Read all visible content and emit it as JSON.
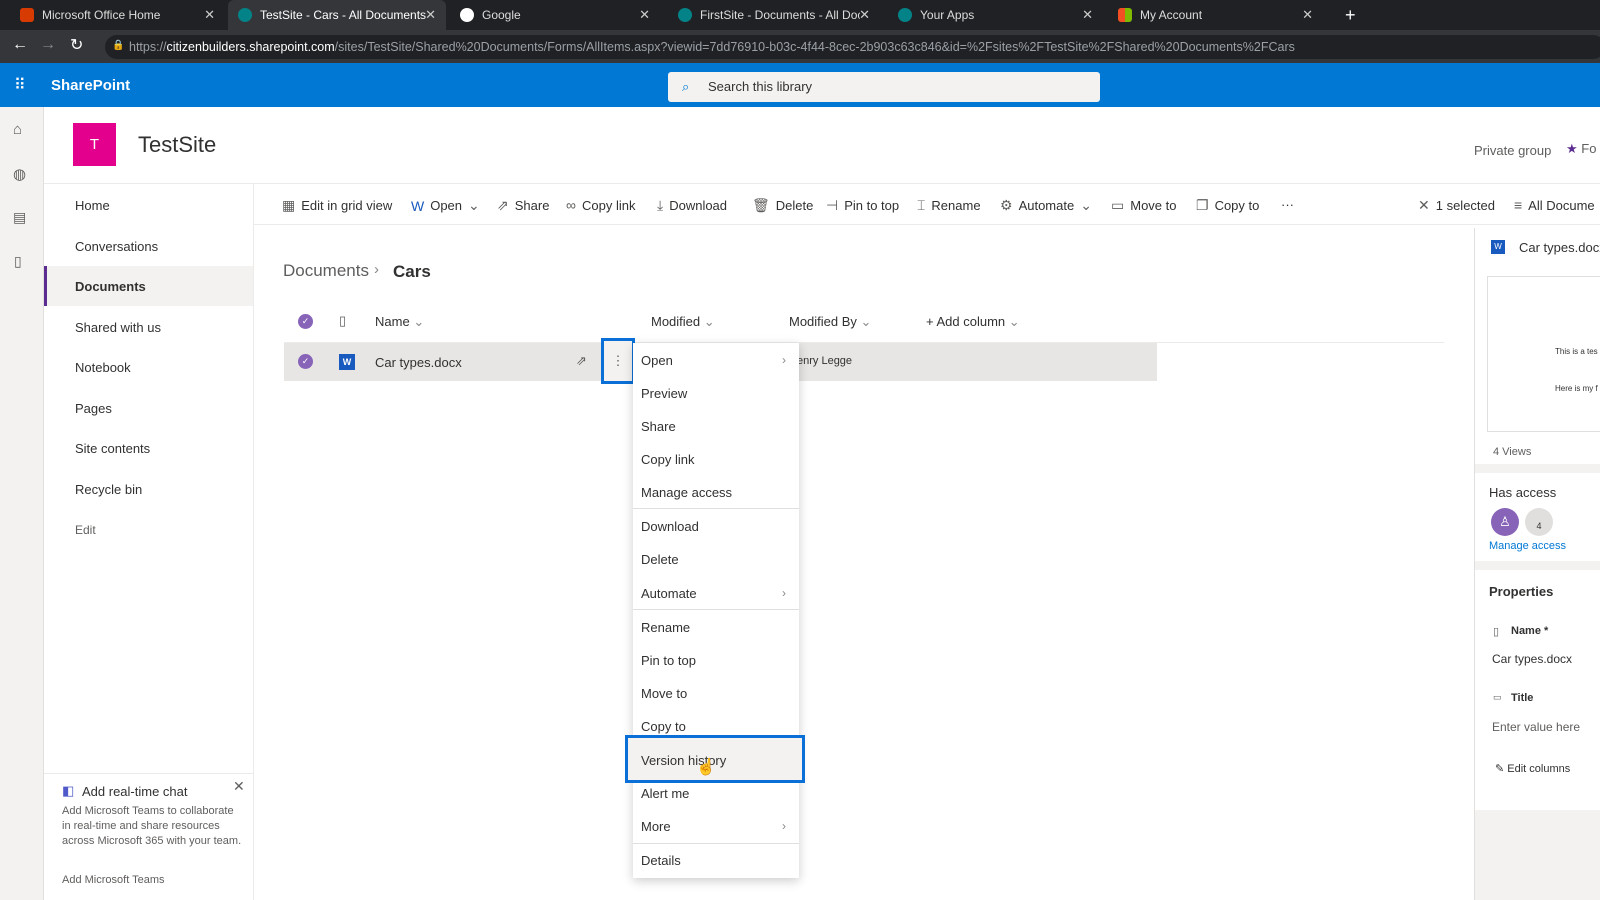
{
  "browser": {
    "tabs": [
      {
        "label": "Microsoft Office Home",
        "color": "#d83b01"
      },
      {
        "label": "TestSite - Cars - All Documents",
        "color": "#038387",
        "active": true
      },
      {
        "label": "Google",
        "color": "#4285f4"
      },
      {
        "label": "FirstSite - Documents - All Docun",
        "color": "#038387"
      },
      {
        "label": "Your Apps",
        "color": "#038387"
      },
      {
        "label": "My Account",
        "color": "#f25022"
      }
    ],
    "url_prefix": "https://",
    "url_domain": "citizenbuilders.sharepoint.com",
    "url_path": "/sites/TestSite/Shared%20Documents/Forms/AllItems.aspx?viewid=7dd76910-b03c-4f44-8cec-2b903c63c846&id=%2Fsites%2FTestSite%2FShared%20Documents%2FCars"
  },
  "suite": {
    "app_name": "SharePoint",
    "search_placeholder": "Search this library",
    "accent": "#0078d4"
  },
  "site": {
    "logo_letter": "T",
    "logo_color": "#e3008c",
    "title": "TestSite",
    "privacy": "Private group",
    "follow": "Fo"
  },
  "nav": {
    "items": [
      "Home",
      "Conversations",
      "Documents",
      "Shared with us",
      "Notebook",
      "Pages",
      "Site contents",
      "Recycle bin"
    ],
    "edit": "Edit",
    "selected": "Documents"
  },
  "commands": {
    "items": [
      "Edit in grid view",
      "Open",
      "Share",
      "Copy link",
      "Download",
      "Delete",
      "Pin to top",
      "Rename",
      "Automate",
      "Move to",
      "Copy to"
    ],
    "more": "···",
    "selected_count": "1 selected",
    "view": "All Docume"
  },
  "breadcrumb": {
    "parent": "Documents",
    "current": "Cars"
  },
  "list": {
    "columns": [
      "Name",
      "Modified",
      "Modified By",
      "+ Add column"
    ],
    "rows": [
      {
        "name": "Car types.docx",
        "modified_by": "enry Legge"
      }
    ]
  },
  "context_menu": {
    "items": [
      "Open",
      "Preview",
      "Share",
      "Copy link",
      "Manage access",
      "Download",
      "Delete",
      "Automate",
      "Rename",
      "Pin to top",
      "Move to",
      "Copy to",
      "Version history",
      "Alert me",
      "More",
      "Details"
    ],
    "highlighted": "Version history"
  },
  "details_pane": {
    "file_name": "Car types.docx",
    "preview_lines": [
      "This is a tes",
      "Here is my f"
    ],
    "views": "4 Views",
    "has_access": "Has access",
    "access_count": "4",
    "manage_access": "Manage access",
    "properties": "Properties",
    "name_label": "Name *",
    "name_value": "Car types.docx",
    "title_label": "Title",
    "title_placeholder": "Enter value here",
    "edit_columns": "Edit columns"
  },
  "teams_card": {
    "title": "Add real-time chat",
    "body": "Add Microsoft Teams to collaborate in real-time and share resources across Microsoft 365 with your team.",
    "link": "Add Microsoft Teams"
  }
}
